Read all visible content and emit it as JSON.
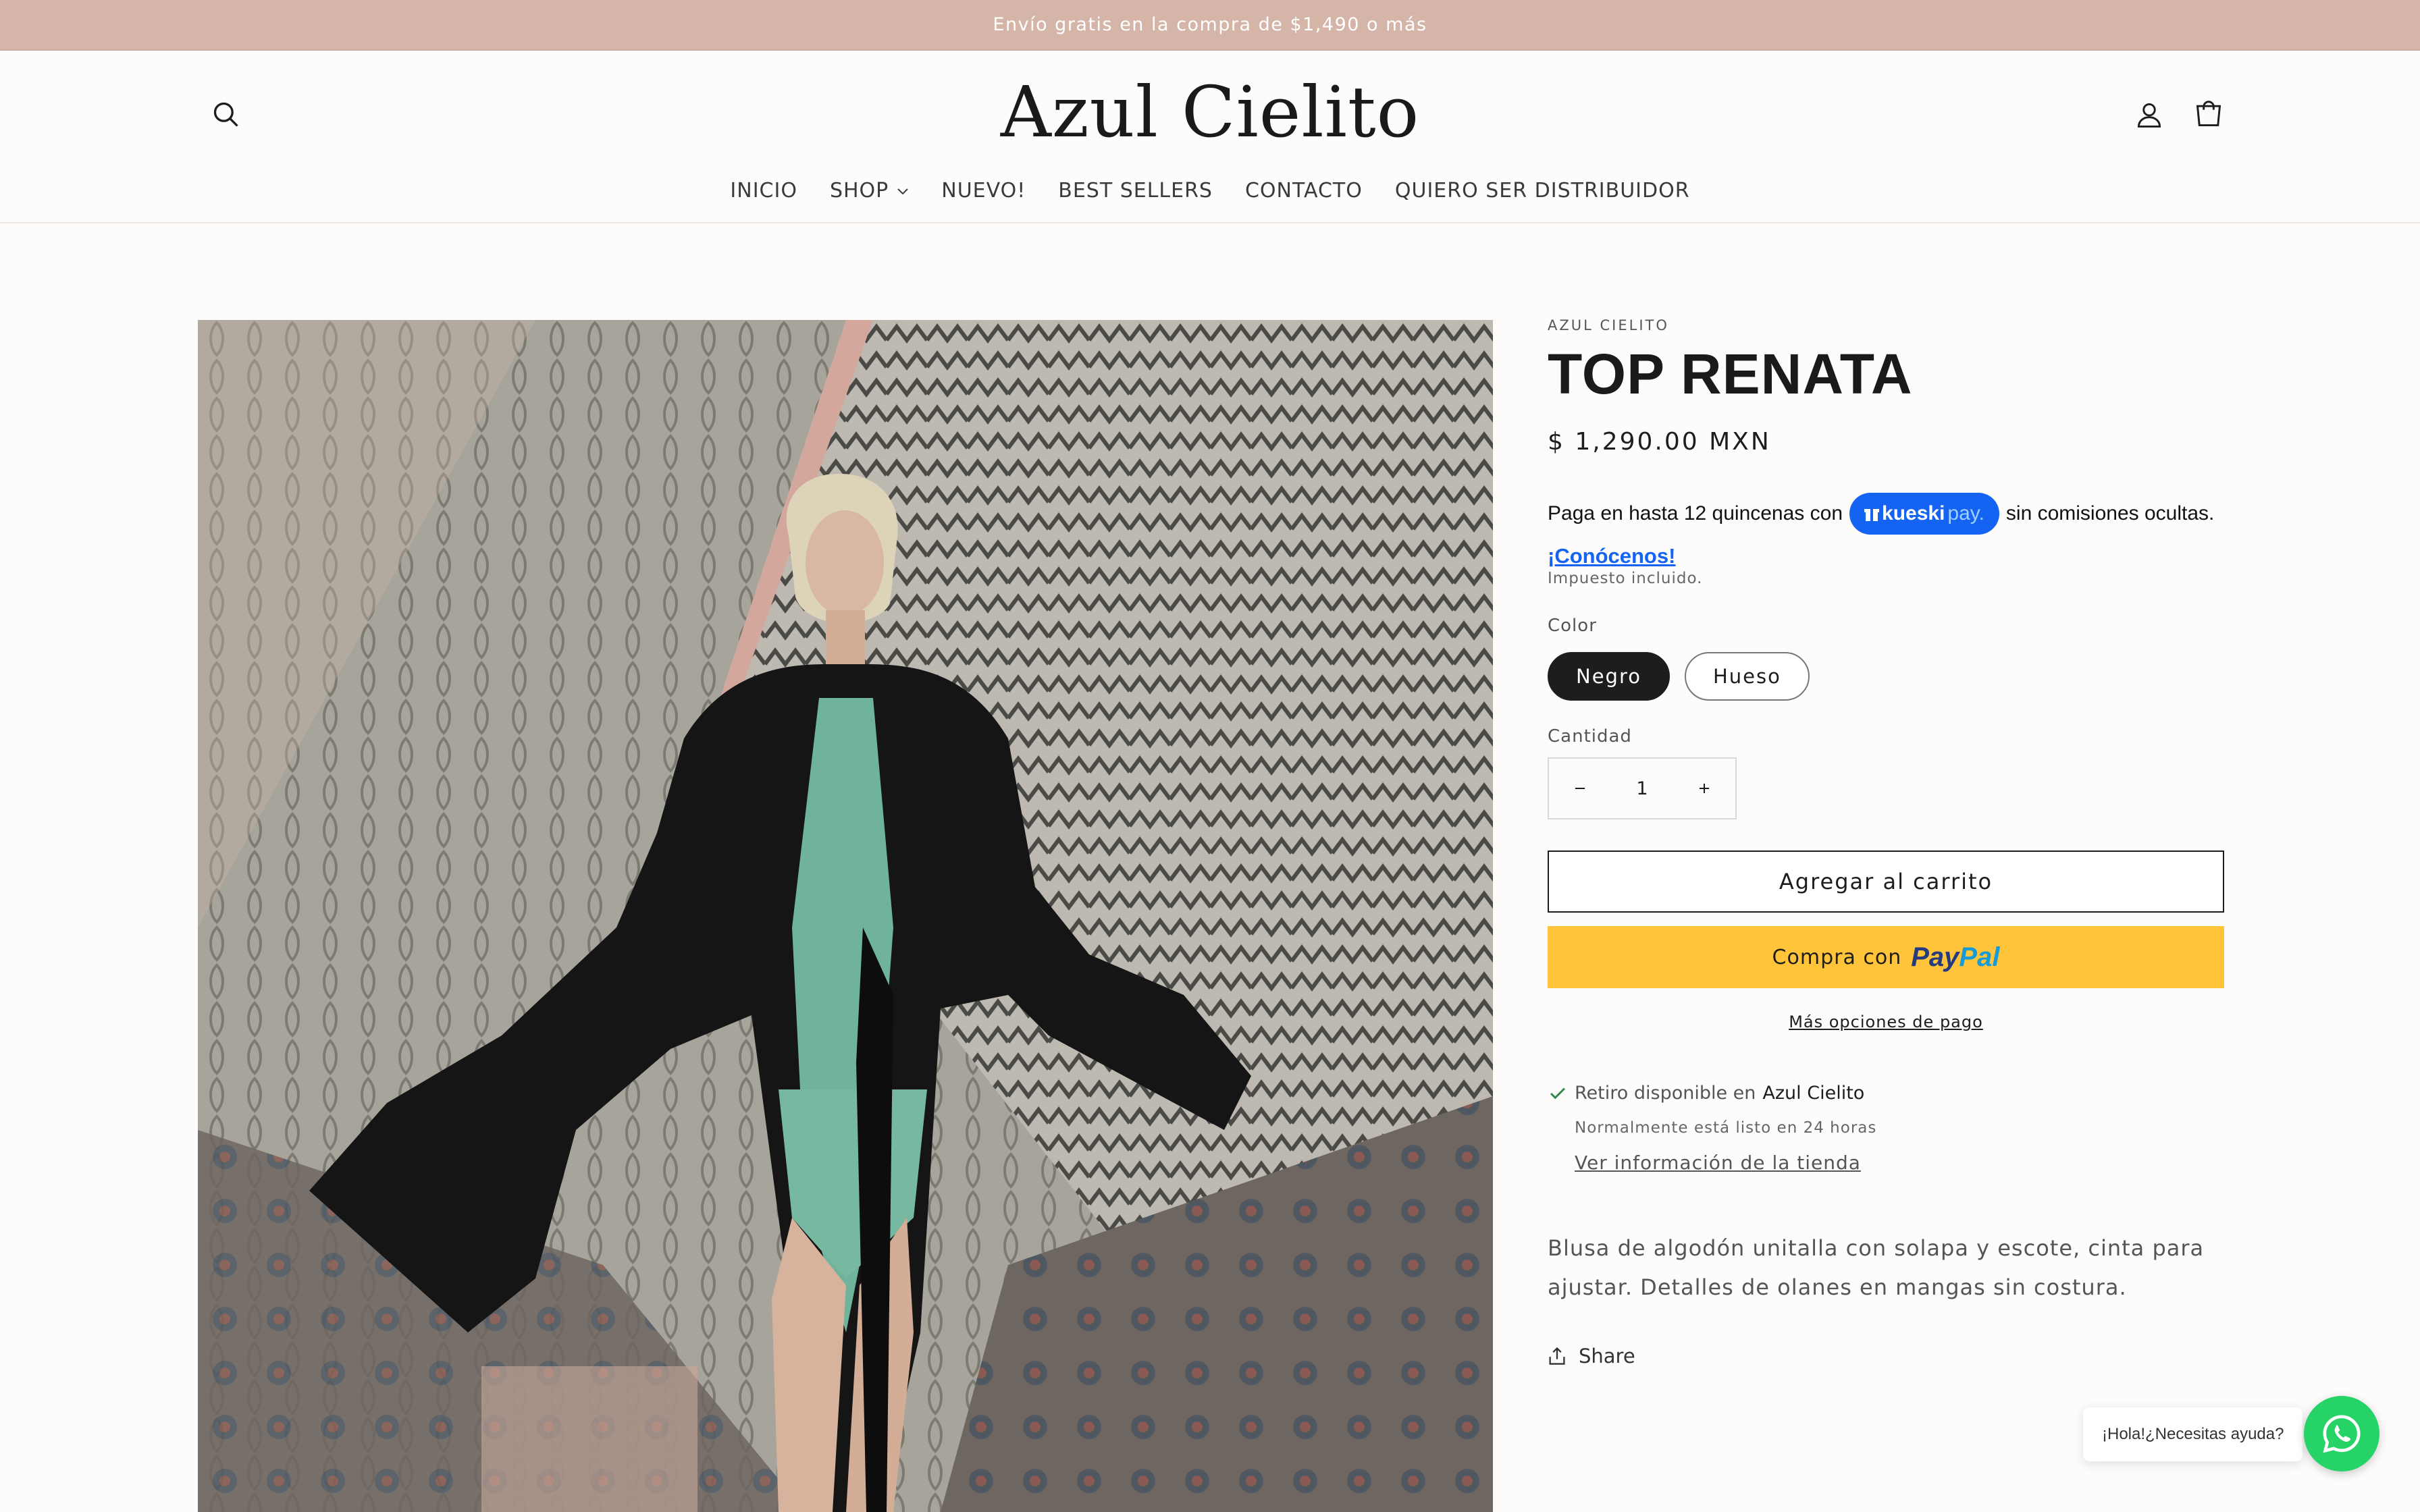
{
  "announcement": "Envío gratis en la compra de $1,490 o más",
  "header": {
    "logo": "Azul Cielito",
    "nav": [
      "INICIO",
      "SHOP",
      "NUEVO!",
      "BEST SELLERS",
      "CONTACTO",
      "QUIERO SER DISTRIBUIDOR"
    ]
  },
  "product": {
    "vendor": "AZUL CIELITO",
    "title": "TOP RENATA",
    "price": "$ 1,290.00 MXN",
    "kueski": {
      "before": "Paga en hasta 12 quincenas con",
      "brand": "kueski",
      "brand_pay": "pay.",
      "after": "sin comisiones ocultas.",
      "link": "¡Conócenos!"
    },
    "tax_note": "Impuesto incluido.",
    "color_label": "Color",
    "colors": [
      "Negro",
      "Hueso"
    ],
    "selected_color": "Negro",
    "quantity_label": "Cantidad",
    "quantity": "1",
    "add_to_cart": "Agregar al carrito",
    "paypal_prefix": "Compra con",
    "paypal_brand_1": "Pay",
    "paypal_brand_2": "Pal",
    "more_payment": "Más opciones de pago",
    "pickup": {
      "available": "Retiro disponible en",
      "store": "Azul Cielito",
      "time": "Normalmente está listo en 24 horas",
      "link": "Ver información de la tienda"
    },
    "description": "Blusa de algodón unitalla con solapa y escote, cinta para ajustar. Detalles de olanes en mangas sin costura.",
    "share": "Share"
  },
  "whatsapp": {
    "bubble": "¡Hola!¿Necesitas ayuda?"
  },
  "colors": {
    "announcement_bg": "#d4b5a8",
    "paypal_yellow": "#ffc439",
    "kueski_blue": "#1463f3",
    "whatsapp_green": "#25d366"
  }
}
